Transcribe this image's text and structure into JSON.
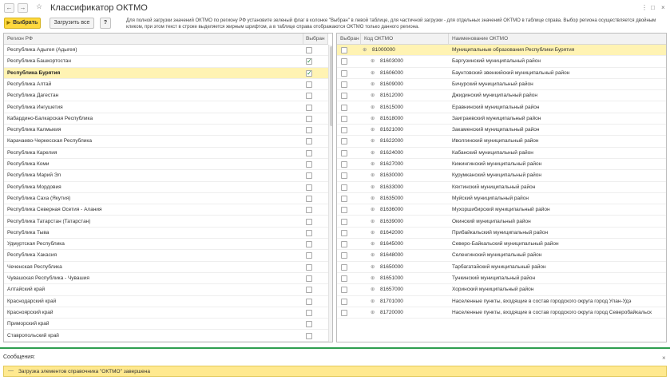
{
  "window": {
    "title": "Классификатор ОКТМО",
    "back": "←",
    "forward": "→",
    "star": "☆",
    "more": "⋮",
    "maximize": "□",
    "close": "×"
  },
  "toolbar": {
    "select_label": "Выбрать",
    "load_all_label": "Загрузить все",
    "help_label": "?",
    "hint": "Для полной загрузки значений ОКТМО по региону РФ установите зеленый флаг в колонке \"Выбран\" в левой таблице, для частичной загрузки - для отдельных значений ОКТМО в таблице справа. Выбор региона осуществляется двойным кликом, при этом текст в строке выделяется жирным шрифтом, а в таблице справа отображаются ОКТМО только данного региона."
  },
  "regions": {
    "headers": {
      "name": "Регион РФ",
      "selected": "Выбран"
    },
    "rows": [
      {
        "name": "Республика Адыгея (Адыгея)",
        "checked": false,
        "bold": false
      },
      {
        "name": "Республика Башкортостан",
        "checked": true,
        "bold": false
      },
      {
        "name": "Республика Бурятия",
        "checked": true,
        "bold": true
      },
      {
        "name": "Республика Алтай",
        "checked": false,
        "bold": false
      },
      {
        "name": "Республика Дагестан",
        "checked": false,
        "bold": false
      },
      {
        "name": "Республика Ингушетия",
        "checked": false,
        "bold": false
      },
      {
        "name": "Кабардино-Балкарская Республика",
        "checked": false,
        "bold": false
      },
      {
        "name": "Республика Калмыкия",
        "checked": false,
        "bold": false
      },
      {
        "name": "Карачаево-Черкесская Республика",
        "checked": false,
        "bold": false
      },
      {
        "name": "Республика Карелия",
        "checked": false,
        "bold": false
      },
      {
        "name": "Республика Коми",
        "checked": false,
        "bold": false
      },
      {
        "name": "Республика Марий Эл",
        "checked": false,
        "bold": false
      },
      {
        "name": "Республика Мордовия",
        "checked": false,
        "bold": false
      },
      {
        "name": "Республика Саха (Якутия)",
        "checked": false,
        "bold": false
      },
      {
        "name": "Республика Северная Осетия - Алания",
        "checked": false,
        "bold": false
      },
      {
        "name": "Республика Татарстан (Татарстан)",
        "checked": false,
        "bold": false
      },
      {
        "name": "Республика Тыва",
        "checked": false,
        "bold": false
      },
      {
        "name": "Удмуртская Республика",
        "checked": false,
        "bold": false
      },
      {
        "name": "Республика Хакасия",
        "checked": false,
        "bold": false
      },
      {
        "name": "Чеченская Республика",
        "checked": false,
        "bold": false
      },
      {
        "name": "Чувашская Республика - Чувашия",
        "checked": false,
        "bold": false
      },
      {
        "name": "Алтайский край",
        "checked": false,
        "bold": false
      },
      {
        "name": "Краснодарский край",
        "checked": false,
        "bold": false
      },
      {
        "name": "Красноярский край",
        "checked": false,
        "bold": false
      },
      {
        "name": "Приморский край",
        "checked": false,
        "bold": false
      },
      {
        "name": "Ставропольский край",
        "checked": false,
        "bold": false
      }
    ]
  },
  "oktmo": {
    "headers": {
      "selected": "Выбран",
      "code": "Код ОКТМО",
      "name": "Наименование ОКТМО"
    },
    "rows": [
      {
        "code": "81000000",
        "name": "Муниципальные образования Республики Бурятия",
        "level": 0,
        "checked": false
      },
      {
        "code": "81603000",
        "name": "Баргузинский муниципальный район",
        "level": 1,
        "checked": false
      },
      {
        "code": "81606000",
        "name": "Баунтовский эвенкийский муниципальный район",
        "level": 1,
        "checked": false
      },
      {
        "code": "81609000",
        "name": "Бичурский муниципальный район",
        "level": 1,
        "checked": false
      },
      {
        "code": "81612000",
        "name": "Джидинский муниципальный район",
        "level": 1,
        "checked": false
      },
      {
        "code": "81615000",
        "name": "Еравнинский муниципальный район",
        "level": 1,
        "checked": false
      },
      {
        "code": "81618000",
        "name": "Заиграевский муниципальный район",
        "level": 1,
        "checked": false
      },
      {
        "code": "81621000",
        "name": "Закаменский муниципальный район",
        "level": 1,
        "checked": false
      },
      {
        "code": "81622000",
        "name": "Иволгинский муниципальный район",
        "level": 1,
        "checked": false
      },
      {
        "code": "81624000",
        "name": "Кабанский муниципальный район",
        "level": 1,
        "checked": false
      },
      {
        "code": "81627000",
        "name": "Кижингинский муниципальный район",
        "level": 1,
        "checked": false
      },
      {
        "code": "81630000",
        "name": "Курумканский муниципальный район",
        "level": 1,
        "checked": false
      },
      {
        "code": "81633000",
        "name": "Кяхтинский муниципальный район",
        "level": 1,
        "checked": false
      },
      {
        "code": "81635000",
        "name": "Муйский муниципальный район",
        "level": 1,
        "checked": false
      },
      {
        "code": "81636000",
        "name": "Мухоршибирский муниципальный район",
        "level": 1,
        "checked": false
      },
      {
        "code": "81639000",
        "name": "Окинский муниципальный район",
        "level": 1,
        "checked": false
      },
      {
        "code": "81642000",
        "name": "Прибайкальский муниципальный район",
        "level": 1,
        "checked": false
      },
      {
        "code": "81645000",
        "name": "Северо-Байкальский муниципальный район",
        "level": 1,
        "checked": false
      },
      {
        "code": "81648000",
        "name": "Селенгинский муниципальный район",
        "level": 1,
        "checked": false
      },
      {
        "code": "81650000",
        "name": "Тарбагатайский муниципальный район",
        "level": 1,
        "checked": false
      },
      {
        "code": "81651000",
        "name": "Тункинский муниципальный район",
        "level": 1,
        "checked": false
      },
      {
        "code": "81657000",
        "name": "Хоринский муниципальный район",
        "level": 1,
        "checked": false
      },
      {
        "code": "81701000",
        "name": "Населенные пункты, входящие в состав городского округа город Улан-Удэ",
        "level": 1,
        "checked": false
      },
      {
        "code": "81720000",
        "name": "Населенные пункты, входящие в состав городского округа город Северобайкальск",
        "level": 1,
        "checked": false
      }
    ]
  },
  "messages": {
    "title": "Сообщения:",
    "close": "×",
    "dash": "—",
    "text": "Загрузка элементов справочника \"ОКТМО\" завершена"
  },
  "icons": {
    "checkmark": "✓",
    "expand": "⊕"
  }
}
